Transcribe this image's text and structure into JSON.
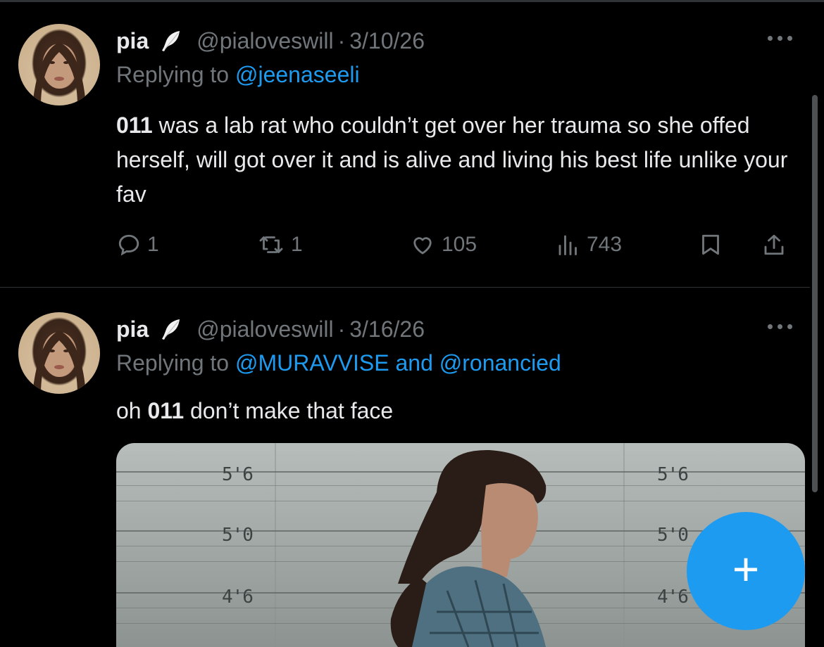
{
  "tweets": [
    {
      "author": "pia",
      "handle": "@pialoveswill",
      "separator": "·",
      "date": "3/10/26",
      "replying_prefix": "Replying to ",
      "replying_to": "@jeenaseeli",
      "text_bold": "011",
      "text_rest": " was a lab rat who couldn’t get over her trauma so she offed herself, will got over it and is alive and living his best life unlike your fav",
      "replies": "1",
      "retweets": "1",
      "likes": "105",
      "views": "743"
    },
    {
      "author": "pia",
      "handle": "@pialoveswill",
      "separator": "·",
      "date": "3/16/26",
      "replying_prefix": "Replying to ",
      "replying_to": "@MURAVVISE",
      "replying_and": " and ",
      "replying_to_2": "@ronancied",
      "text_before": "oh ",
      "text_bold": "011",
      "text_after": " don’t make that face",
      "media_labels": {
        "l1": "5'6",
        "l2": "5'0",
        "l3": "4'6",
        "r1": "5'6",
        "r2": "5'0",
        "r3": "4'6"
      }
    }
  ],
  "fab": {
    "label": "+"
  },
  "colors": {
    "accent": "#1d9bf0",
    "muted": "#71767b",
    "text": "#e7e9ea",
    "background": "#000000"
  },
  "icons": [
    "feather-icon",
    "more-icon",
    "reply-icon",
    "retweet-icon",
    "like-icon",
    "views-icon",
    "bookmark-icon",
    "share-icon",
    "plus-icon"
  ]
}
